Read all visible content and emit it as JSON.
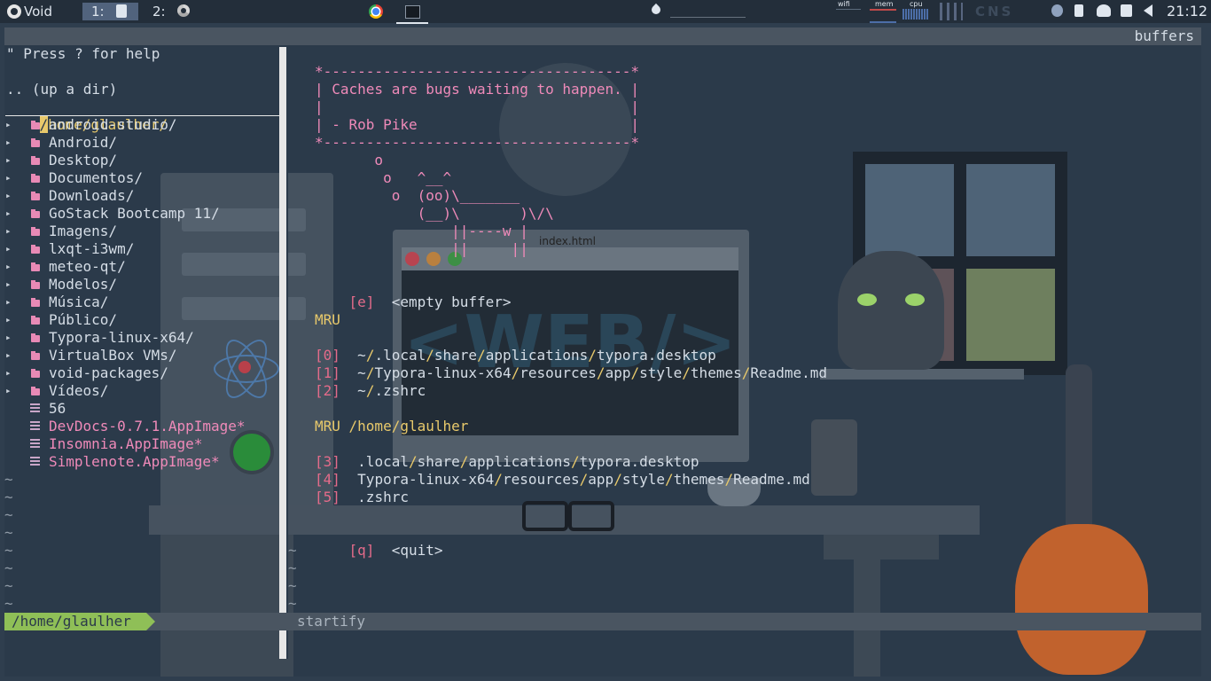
{
  "topbar": {
    "os_name": "Void",
    "workspace1": "1:",
    "workspace2": "2:",
    "wifi": "wifi",
    "mem": "mem",
    "cpu": "cpu",
    "cns": "CNS",
    "clock": "21:12"
  },
  "term": {
    "header_right": "buffers",
    "help": "\" Press ? for help",
    "up_dir": ".. (up a dir)",
    "cwd_slash": "/",
    "cwd_path": "home/glaulher/",
    "tree": [
      {
        "name": "android-studio/",
        "type": "dir"
      },
      {
        "name": "Android/",
        "type": "dir"
      },
      {
        "name": "Desktop/",
        "type": "dir"
      },
      {
        "name": "Documentos/",
        "type": "dir"
      },
      {
        "name": "Downloads/",
        "type": "dir"
      },
      {
        "name": "GoStack Bootcamp 11/",
        "type": "dir"
      },
      {
        "name": "Imagens/",
        "type": "dir"
      },
      {
        "name": "lxqt-i3wm/",
        "type": "dir"
      },
      {
        "name": "meteo-qt/",
        "type": "dir"
      },
      {
        "name": "Modelos/",
        "type": "dir"
      },
      {
        "name": "Música/",
        "type": "dir"
      },
      {
        "name": "Público/",
        "type": "dir"
      },
      {
        "name": "Typora-linux-x64/",
        "type": "dir"
      },
      {
        "name": "VirtualBox VMs/",
        "type": "dir"
      },
      {
        "name": "void-packages/",
        "type": "dir"
      },
      {
        "name": "Vídeos/",
        "type": "dir"
      },
      {
        "name": "56",
        "type": "file"
      },
      {
        "name": "DevDocs-0.7.1.AppImage*",
        "type": "exec"
      },
      {
        "name": "Insomnia.AppImage*",
        "type": "exec"
      },
      {
        "name": "Simplenote.AppImage*",
        "type": "exec"
      }
    ],
    "quote": [
      "*------------------------------------*",
      "| Caches are bugs waiting to happen. |",
      "|                                    |",
      "| - Rob Pike                         |",
      "*------------------------------------*",
      "       o",
      "        o   ^__^",
      "         o  (oo)\\_______",
      "            (__)\\       )\\/\\",
      "                ||----w |",
      "                ||     ||"
    ],
    "empty_key": "[e]",
    "empty_label": "<empty buffer>",
    "mru_title": "MRU",
    "mru": [
      {
        "key": "[0]",
        "prefix": "~",
        "parts": [
          "/",
          ".local",
          "/",
          "share",
          "/",
          "applications",
          "/",
          "typora.desktop"
        ]
      },
      {
        "key": "[1]",
        "prefix": "~",
        "parts": [
          "/",
          "Typora-linux-x64",
          "/",
          "resources",
          "/",
          "app",
          "/",
          "style",
          "/",
          "themes",
          "/",
          "Readme.md"
        ]
      },
      {
        "key": "[2]",
        "prefix": "~",
        "parts": [
          "/",
          ".zshrc"
        ]
      }
    ],
    "mru_dir_title": "MRU /home/glaulher",
    "mru_dir": [
      {
        "key": "[3]",
        "parts": [
          ".local",
          "/",
          "share",
          "/",
          "applications",
          "/",
          "typora.desktop"
        ]
      },
      {
        "key": "[4]",
        "parts": [
          "Typora-linux-x64",
          "/",
          "resources",
          "/",
          "app",
          "/",
          "style",
          "/",
          "themes",
          "/",
          "Readme.md"
        ]
      },
      {
        "key": "[5]",
        "parts": [
          ".zshrc"
        ]
      }
    ],
    "quit_key": "[q]",
    "quit_label": "<quit>",
    "status_left": "/home/glaulher",
    "status_right": "startify",
    "wallpaper_tab": "index.html",
    "wallpaper_text": "<WEB/>"
  }
}
